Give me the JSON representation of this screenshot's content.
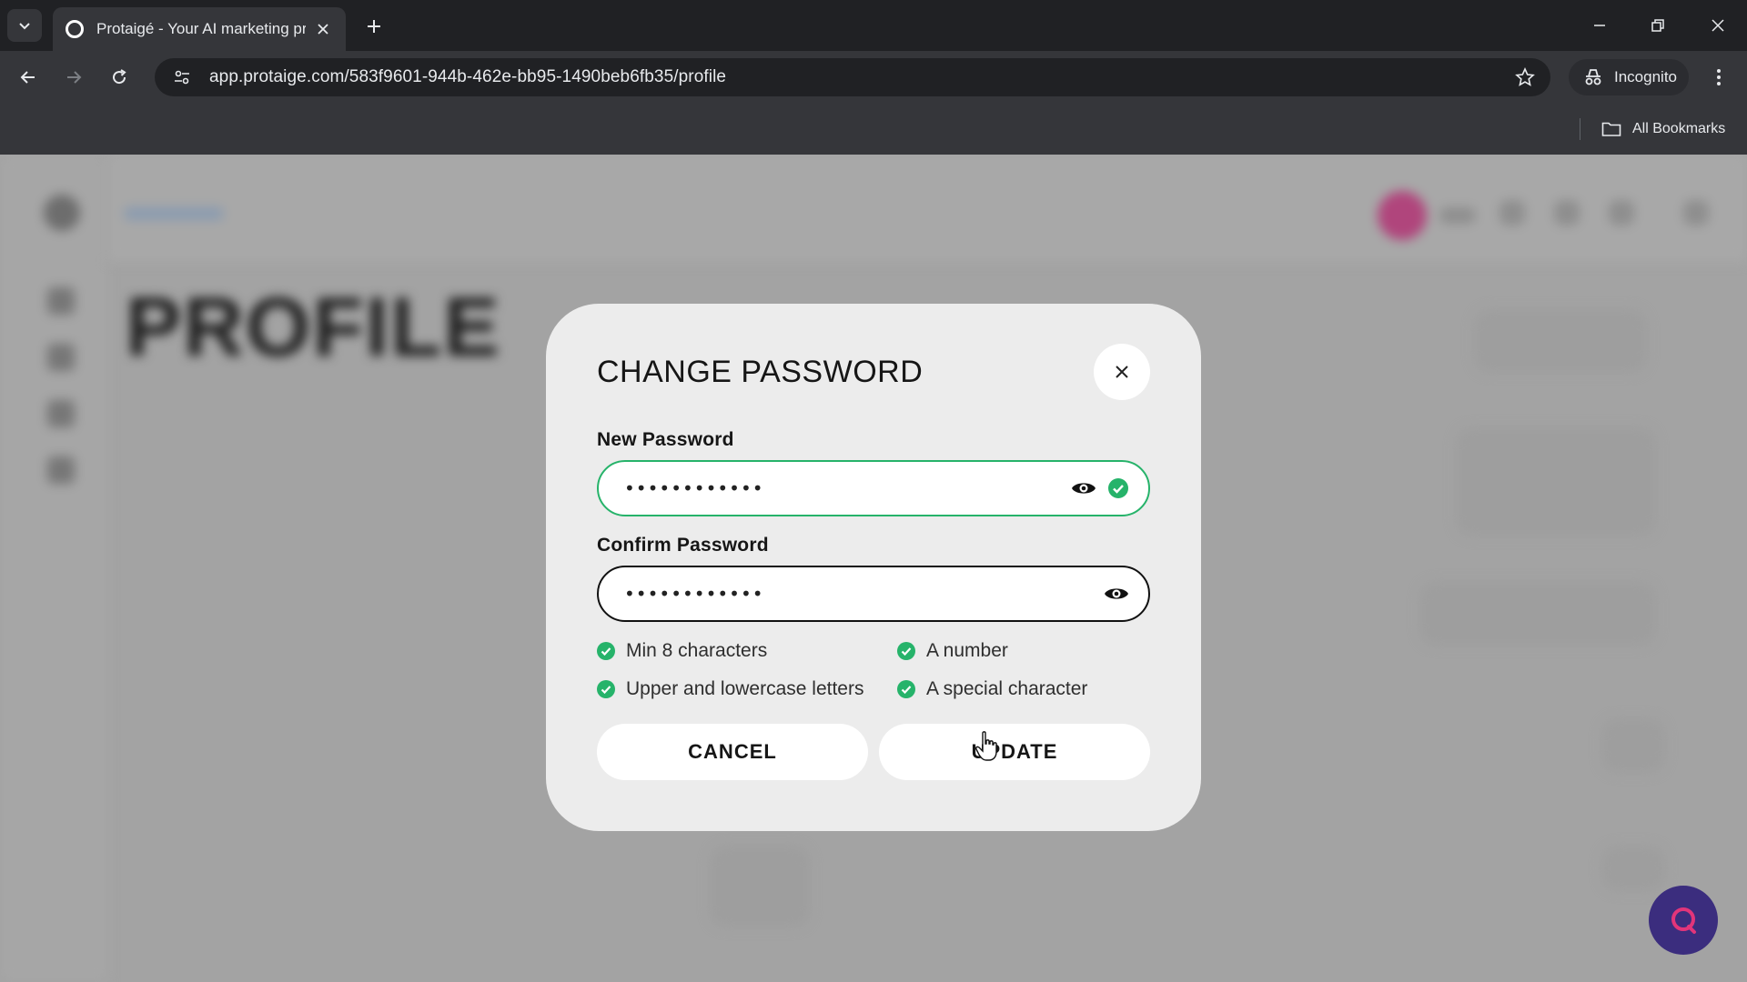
{
  "browser": {
    "tab_title": "Protaigé - Your AI marketing pr",
    "url": "app.protaige.com/583f9601-944b-462e-bb95-1490beb6fb35/profile",
    "incognito_label": "Incognito",
    "bookmarks_label": "All Bookmarks"
  },
  "background": {
    "page_heading": "PROFILE"
  },
  "modal": {
    "title": "CHANGE PASSWORD",
    "new_password_label": "New Password",
    "new_password_value": "••••••••••••",
    "confirm_password_label": "Confirm Password",
    "confirm_password_value": "••••••••••••",
    "requirements": [
      {
        "label": "Min 8 characters",
        "met": true
      },
      {
        "label": "A number",
        "met": true
      },
      {
        "label": "Upper and lowercase letters",
        "met": true
      },
      {
        "label": "A special character",
        "met": true
      }
    ],
    "cancel_label": "CANCEL",
    "update_label": "UPDATE"
  },
  "colors": {
    "valid_green": "#26b36a",
    "modal_bg": "#ececec",
    "chat_button": "#3b2d7e",
    "chat_icon": "#e2357a"
  },
  "icons": {
    "toggle_visibility": "eye-icon",
    "valid": "check-circle-icon",
    "close": "close-icon"
  }
}
